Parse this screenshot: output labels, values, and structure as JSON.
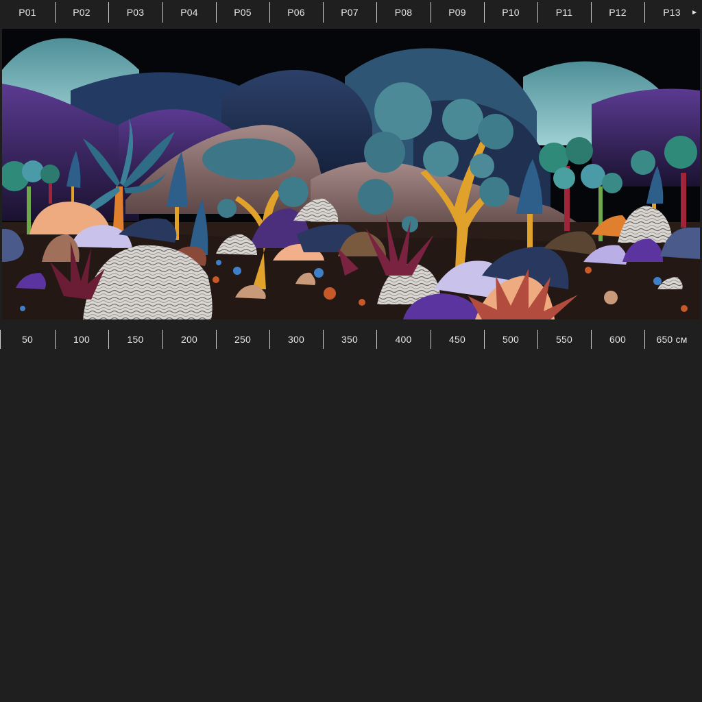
{
  "panels": {
    "labels": [
      "P01",
      "P02",
      "P03",
      "P04",
      "P05",
      "P06",
      "P07",
      "P08",
      "P09",
      "P10",
      "P11",
      "P12",
      "P13"
    ],
    "more_icon": "triangle-right-icon"
  },
  "ruler": {
    "marks": [
      "50",
      "100",
      "150",
      "200",
      "250",
      "300",
      "350",
      "400",
      "450",
      "500",
      "550",
      "600",
      "650 см"
    ]
  },
  "artwork": {
    "palette": {
      "background": "#1f1f1f",
      "sky": "#05060a",
      "ground": "#2a1d18",
      "teal": "#4a8a96",
      "navy": "#28385f",
      "purple": "#4b2f7c",
      "mustard": "#e1a22b",
      "pink": "#a58a88",
      "peach": "#eeab7f",
      "lavender": "#c9c3eb",
      "crimson": "#7a2340"
    }
  }
}
